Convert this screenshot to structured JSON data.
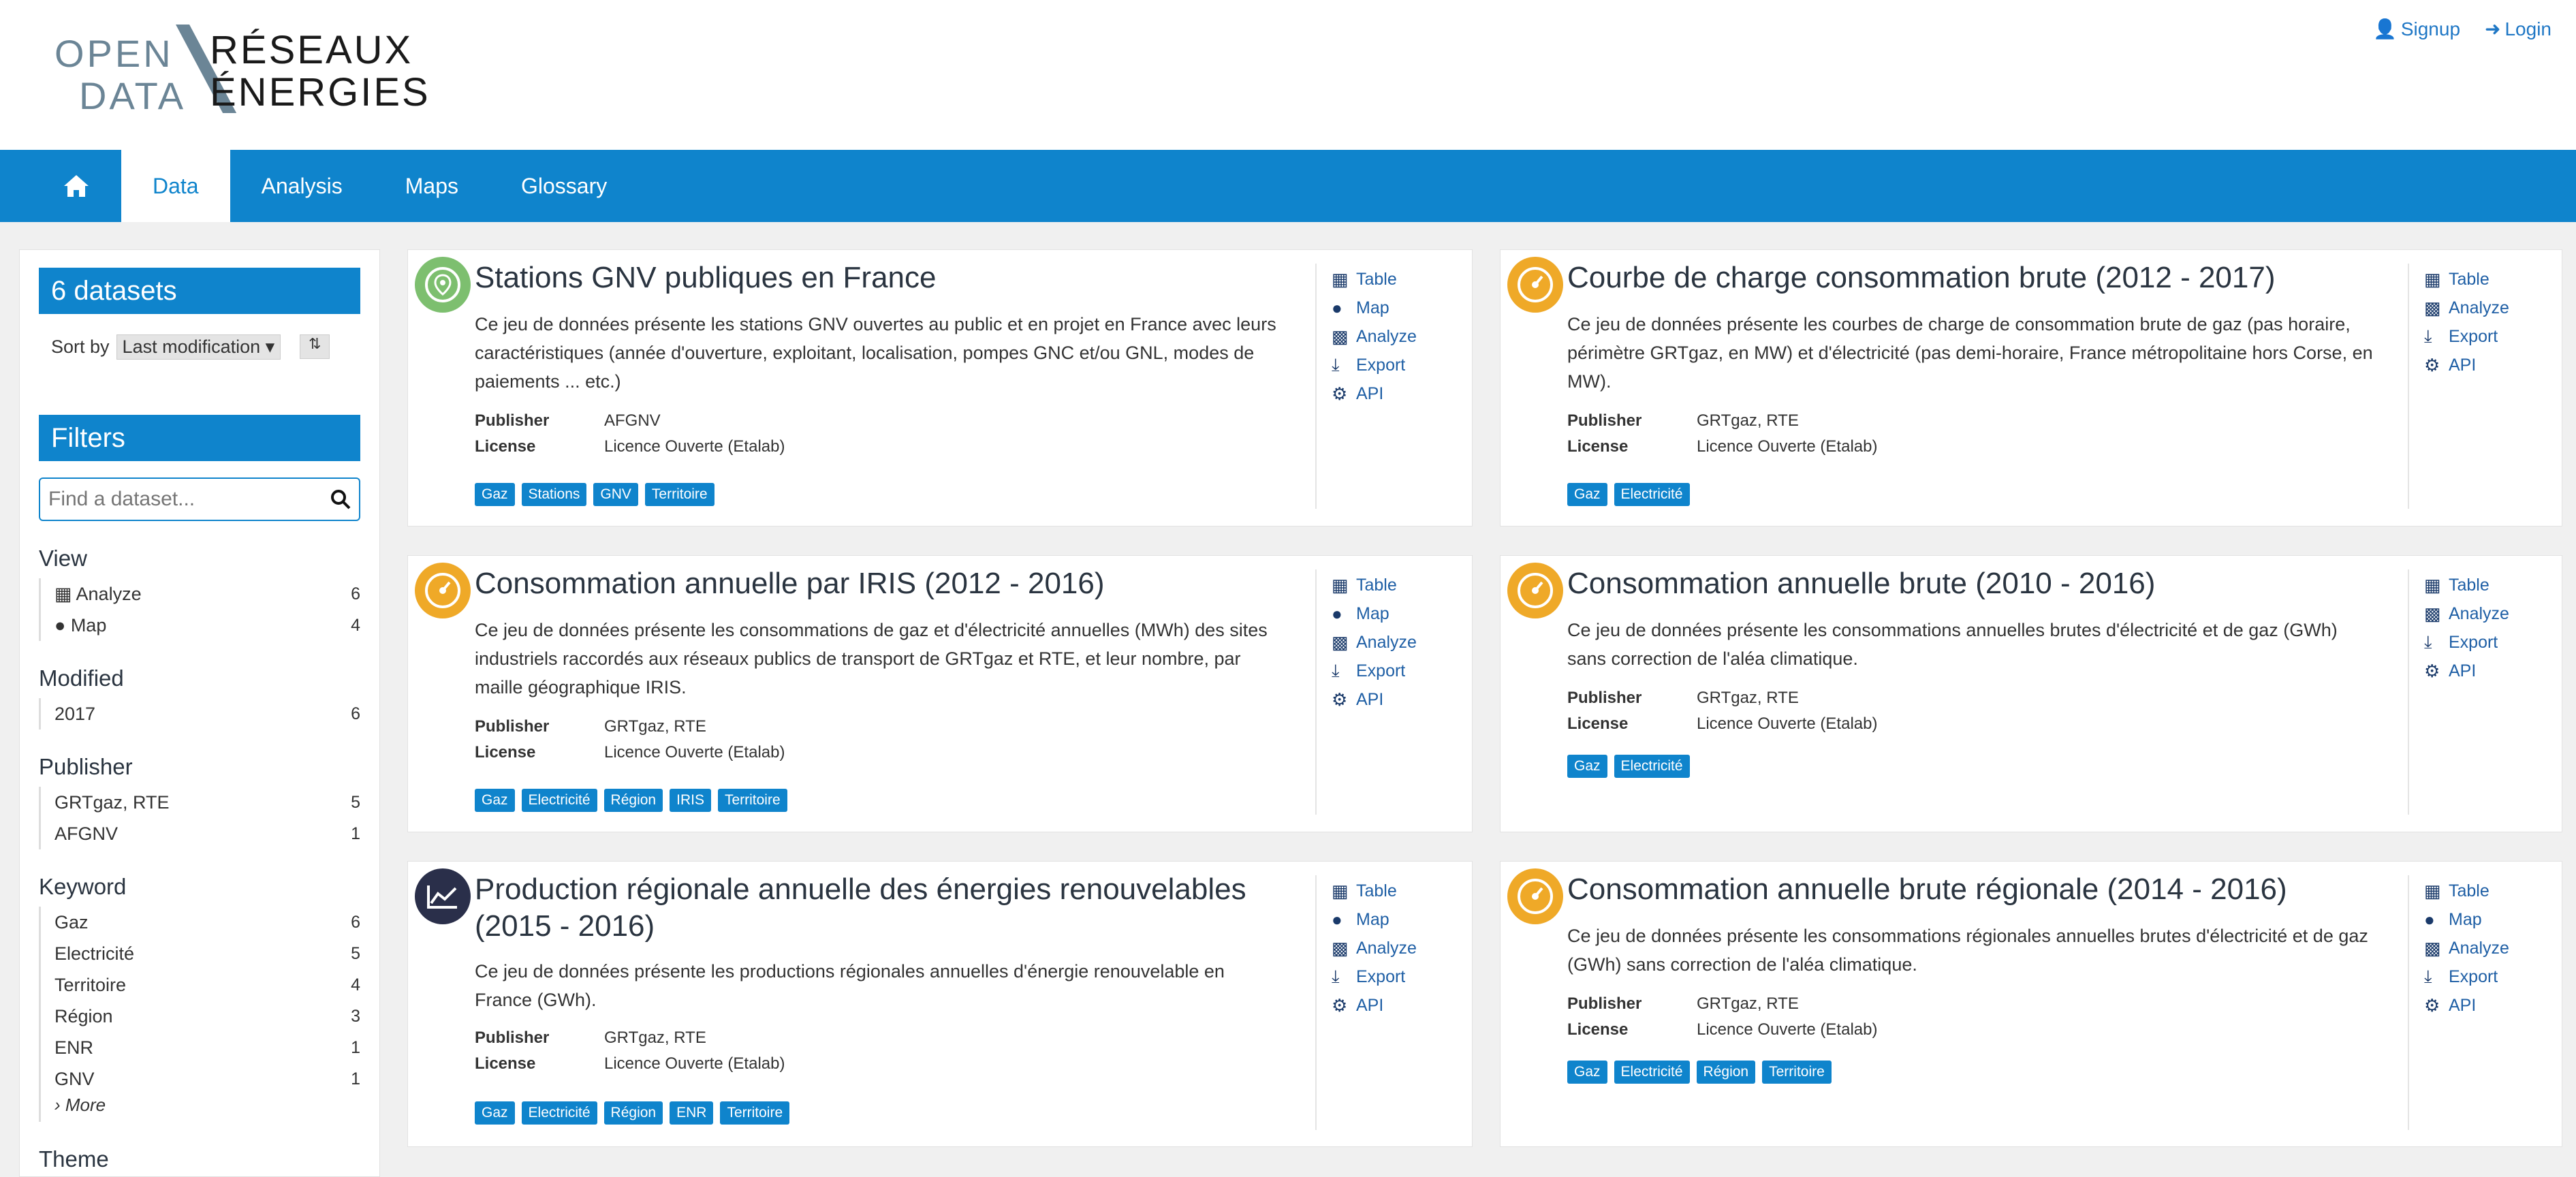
{
  "header": {
    "logo": {
      "open": "OPEN",
      "data": "DATA",
      "reseaux": "RÉSEAUX",
      "energies": "ÉNERGIES"
    },
    "signup": "Signup",
    "login": "Login"
  },
  "nav": {
    "home_icon": "home-icon",
    "items": [
      "Data",
      "Analysis",
      "Maps",
      "Glossary"
    ],
    "active": "Data"
  },
  "sidebar": {
    "count": "6 datasets",
    "sort_label": "Sort by",
    "sort_value": "Last modification",
    "filters_title": "Filters",
    "search_placeholder": "Find a dataset...",
    "view_title": "View",
    "view_items": [
      {
        "label": "Analyze",
        "count": "6"
      },
      {
        "label": "Map",
        "count": "4"
      }
    ],
    "modified_title": "Modified",
    "modified_items": [
      {
        "label": "2017",
        "count": "6"
      }
    ],
    "publisher_title": "Publisher",
    "publisher_items": [
      {
        "label": "GRTgaz, RTE",
        "count": "5"
      },
      {
        "label": "AFGNV",
        "count": "1"
      }
    ],
    "keyword_title": "Keyword",
    "keyword_items": [
      {
        "label": "Gaz",
        "count": "6"
      },
      {
        "label": "Electricité",
        "count": "5"
      },
      {
        "label": "Territoire",
        "count": "4"
      },
      {
        "label": "Région",
        "count": "3"
      },
      {
        "label": "ENR",
        "count": "1"
      },
      {
        "label": "GNV",
        "count": "1"
      }
    ],
    "more": "More",
    "theme_title": "Theme"
  },
  "labels": {
    "publisher": "Publisher",
    "license": "License"
  },
  "actions_text": {
    "Table": "Table",
    "Map": "Map",
    "Analyze": "Analyze",
    "Export": "Export",
    "API": "API"
  },
  "datasets": [
    {
      "title": "Stations GNV publiques en France",
      "description": "Ce jeu de données présente les stations GNV ouvertes au public et en projet en France avec leurs caractéristiques (année d'ouverture, exploitant, localisation, pompes GNC et/ou GNL, modes de paiements ... etc.)",
      "publisher": "AFGNV",
      "license": "Licence Ouverte (Etalab)",
      "tags": [
        "Gaz",
        "Stations",
        "GNV",
        "Territoire"
      ],
      "actions": [
        "Table",
        "Map",
        "Analyze",
        "Export",
        "API"
      ],
      "badge_color": "#7dbf6f",
      "badge_icon": "map-pin-icon"
    },
    {
      "title": "Courbe de charge consommation brute (2012 - 2017)",
      "description": "Ce jeu de données présente les courbes de charge de consommation brute de gaz (pas horaire, périmètre GRTgaz, en MW) et d'électricité (pas demi-horaire, France métropolitaine hors Corse, en MW).",
      "publisher": "GRTgaz, RTE",
      "license": "Licence Ouverte (Etalab)",
      "tags": [
        "Gaz",
        "Electricité"
      ],
      "actions": [
        "Table",
        "Analyze",
        "Export",
        "API"
      ],
      "badge_color": "#efa928",
      "badge_icon": "gauge-icon"
    },
    {
      "title": "Consommation annuelle par IRIS (2012 - 2016)",
      "description": "Ce jeu de données présente les consommations de gaz et d'électricité annuelles (MWh) des sites industriels raccordés aux réseaux publics de transport de GRTgaz et RTE, et leur nombre, par maille géographique IRIS.",
      "publisher": "GRTgaz, RTE",
      "license": "Licence Ouverte (Etalab)",
      "tags": [
        "Gaz",
        "Electricité",
        "Région",
        "IRIS",
        "Territoire"
      ],
      "actions": [
        "Table",
        "Map",
        "Analyze",
        "Export",
        "API"
      ],
      "badge_color": "#efa928",
      "badge_icon": "gauge-icon"
    },
    {
      "title": "Consommation annuelle brute (2010 - 2016)",
      "description": "Ce jeu de données présente les consommations annuelles brutes d'électricité et de gaz (GWh) sans correction de l'aléa climatique.",
      "publisher": "GRTgaz, RTE",
      "license": "Licence Ouverte (Etalab)",
      "tags": [
        "Gaz",
        "Electricité"
      ],
      "actions": [
        "Table",
        "Analyze",
        "Export",
        "API"
      ],
      "badge_color": "#efa928",
      "badge_icon": "gauge-icon"
    },
    {
      "title": "Production régionale annuelle des énergies renouvelables (2015 - 2016)",
      "description": "Ce jeu de données présente les productions régionales annuelles d'énergie renouvelable en France (GWh).",
      "publisher": "GRTgaz, RTE",
      "license": "Licence Ouverte (Etalab)",
      "tags": [
        "Gaz",
        "Electricité",
        "Région",
        "ENR",
        "Territoire"
      ],
      "actions": [
        "Table",
        "Map",
        "Analyze",
        "Export",
        "API"
      ],
      "badge_color": "#2a2f4a",
      "badge_icon": "line-chart-icon"
    },
    {
      "title": "Consommation annuelle brute régionale (2014 - 2016)",
      "description": "Ce jeu de données présente les consommations régionales annuelles brutes d'électricité et de gaz (GWh) sans correction de l'aléa climatique.",
      "publisher": "GRTgaz, RTE",
      "license": "Licence Ouverte (Etalab)",
      "tags": [
        "Gaz",
        "Electricité",
        "Région",
        "Territoire"
      ],
      "actions": [
        "Table",
        "Map",
        "Analyze",
        "Export",
        "API"
      ],
      "badge_color": "#efa928",
      "badge_icon": "gauge-icon"
    }
  ]
}
